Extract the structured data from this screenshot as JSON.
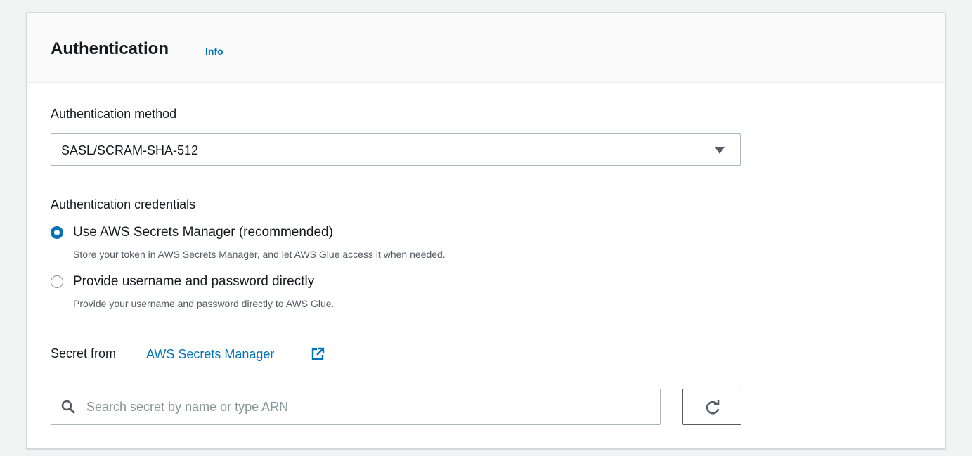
{
  "section": {
    "title": "Authentication",
    "info_label": "Info"
  },
  "auth_method": {
    "label": "Authentication method",
    "selected_value": "SASL/SCRAM-SHA-512"
  },
  "credentials": {
    "label": "Authentication credentials",
    "options": [
      {
        "label": "Use AWS Secrets Manager (recommended)",
        "description": "Store your token in AWS Secrets Manager, and let AWS Glue access it when needed.",
        "selected": true
      },
      {
        "label": "Provide username and password directly",
        "description": "Provide your username and password directly to AWS Glue.",
        "selected": false
      }
    ]
  },
  "secret": {
    "label": "Secret from",
    "link_text": "AWS Secrets Manager",
    "search_placeholder": "Search secret by name or type ARN",
    "search_value": ""
  },
  "colors": {
    "accent": "#0073bb",
    "border": "#aab7b8",
    "text": "#16191f",
    "muted_text": "#545b64"
  },
  "icons": {
    "dropdown": "caret-down-icon",
    "external_link": "external-link-icon",
    "search": "search-icon",
    "refresh": "refresh-icon"
  }
}
